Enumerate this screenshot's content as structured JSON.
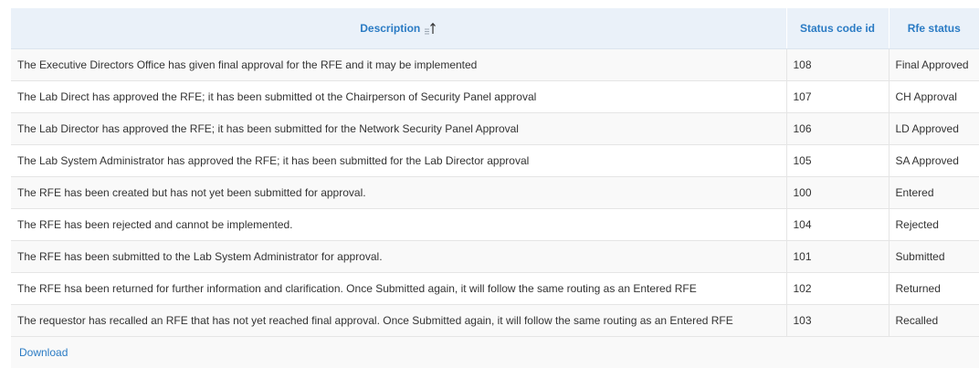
{
  "table": {
    "headers": {
      "description": "Description",
      "status_code_id": "Status code id",
      "rfe_status": "Rfe status"
    },
    "sort": {
      "column": "description",
      "icon": "sort-ascending-icon"
    },
    "rows": [
      {
        "description": "The Executive Directors Office has given final approval for the RFE and it may be implemented",
        "status_code_id": "108",
        "rfe_status": "Final Approved"
      },
      {
        "description": "The Lab Direct has approved the RFE; it has been submitted ot the Chairperson of Security Panel approval",
        "status_code_id": "107",
        "rfe_status": "CH Approval"
      },
      {
        "description": "The Lab Director has approved the RFE; it has been submitted for the Network Security Panel Approval",
        "status_code_id": "106",
        "rfe_status": "LD Approved"
      },
      {
        "description": "The Lab System Administrator has approved the RFE; it has been submitted for the Lab Director approval",
        "status_code_id": "105",
        "rfe_status": "SA Approved"
      },
      {
        "description": "The RFE has been created but has not yet been submitted for approval.",
        "status_code_id": "100",
        "rfe_status": "Entered"
      },
      {
        "description": "The RFE has been rejected and cannot be implemented.",
        "status_code_id": "104",
        "rfe_status": "Rejected"
      },
      {
        "description": "The RFE has been submitted to the Lab System Administrator for approval.",
        "status_code_id": "101",
        "rfe_status": "Submitted"
      },
      {
        "description": "The RFE hsa been returned for further information and clarification. Once Submitted again, it will follow the same routing as an Entered RFE",
        "status_code_id": "102",
        "rfe_status": "Returned"
      },
      {
        "description": "The requestor has recalled an RFE that has not yet reached final approval. Once Submitted again, it will follow the same routing as an Entered RFE",
        "status_code_id": "103",
        "rfe_status": "Recalled"
      }
    ]
  },
  "footer": {
    "download_label": "Download"
  },
  "colors": {
    "header_bg": "#eaf1f9",
    "link": "#2a7bc4",
    "row_alt": "#f9f9f9"
  }
}
